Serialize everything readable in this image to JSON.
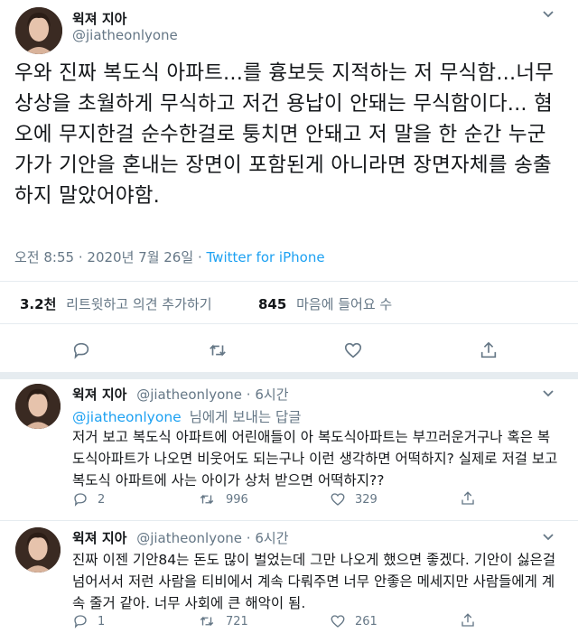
{
  "main_tweet": {
    "display_name": "윅져 지아",
    "handle": "@jiatheonlyone",
    "text": "우와 진짜 복도식 아파트...를 흉보듯 지적하는 저 무식함...너무 상상을 초월하게 무식하고 저건 용납이 안돼는 무식함이다... 혐오에 무지한걸 순수한걸로 퉁치면 안돼고 저 말을 한 순간 누군가가 기안을 혼내는 장면이 포함된게 아니라면 장면자체를 송출하지 말았어야함.",
    "time": "오전 8:55",
    "separator": "·",
    "date": "2020년 7월 26일",
    "source": "Twitter for iPhone",
    "retweet_count": "3.2천",
    "retweet_label": "리트윗하고 의견 추가하기",
    "like_count": "845",
    "like_label": "마음에 들어요 수"
  },
  "replies": [
    {
      "display_name": "윅져 지아",
      "handle": "@jiatheonlyone",
      "dot": "·",
      "time_ago": "6시간",
      "reply_to_handle": "@jiatheonlyone",
      "reply_to_suffix": "님에게 보내는 답글",
      "text": "저거 보고 복도식 아파트에 어린애들이 아 복도식아파트는 부끄러운거구나 혹은 복도식아파트가 나오면 비웃어도 되는구나 이런 생각하면 어떡하지? 실제로 저걸 보고 복도식 아파트에 사는 아이가 상처 받으면 어떡하지??",
      "reply_count": "2",
      "retweet_count": "996",
      "like_count": "329"
    },
    {
      "display_name": "윅져 지아",
      "handle": "@jiatheonlyone",
      "dot": "·",
      "time_ago": "6시간",
      "text": "진짜 이젠 기안84는 돈도 많이 벌었는데 그만 나오게 했으면 좋겠다. 기안이 싫은걸 넘어서서 저런 사람을 티비에서 계속 다뤄주면 너무 안좋은 메세지만 사람들에게 계속 줄거 같아. 너무 사회에 큰 해악이 됨.",
      "reply_count": "1",
      "retweet_count": "721",
      "like_count": "261"
    }
  ],
  "icons": {
    "caret": "chevron-down",
    "reply": "speech-bubble",
    "retweet": "retweet-arrows",
    "like": "heart",
    "share": "share-upload"
  },
  "colors": {
    "link": "#1da1f2",
    "muted": "#657786",
    "text": "#14171a",
    "divider": "#e6ecf0"
  }
}
